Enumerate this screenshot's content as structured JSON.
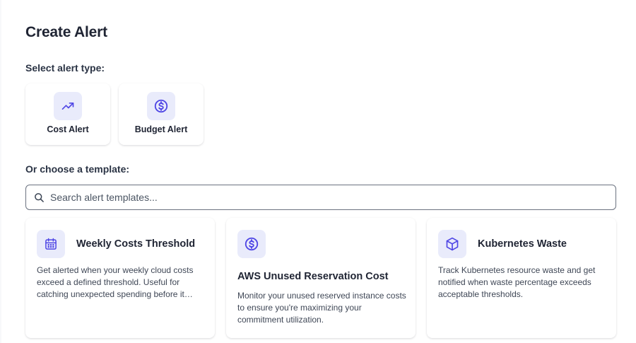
{
  "page": {
    "title": "Create Alert",
    "select_type_label": "Select alert type:",
    "template_label": "Or choose a template:"
  },
  "alert_types": [
    {
      "label": "Cost Alert",
      "icon": "trending-up-icon"
    },
    {
      "label": "Budget Alert",
      "icon": "dollar-circle-icon"
    }
  ],
  "search": {
    "placeholder": "Search alert templates...",
    "value": ""
  },
  "templates": [
    {
      "title": "Weekly Costs Threshold",
      "icon": "calendar-icon",
      "description": "Get alerted when your weekly cloud costs exceed a defined threshold. Useful for catching unexpected spending before it becomes a problem."
    },
    {
      "title": "AWS Unused Reservation Cost",
      "icon": "dollar-circle-icon",
      "description": "Monitor your unused reserved instance costs to ensure you're maximizing your commitment utilization."
    },
    {
      "title": "Kubernetes Waste",
      "icon": "cube-icon",
      "description": "Track Kubernetes resource waste and get notified when waste percentage exceeds acceptable thresholds."
    }
  ],
  "colors": {
    "accent": "#4f46e5",
    "icon_bg": "#e9ebfb",
    "text": "#1f2433"
  }
}
